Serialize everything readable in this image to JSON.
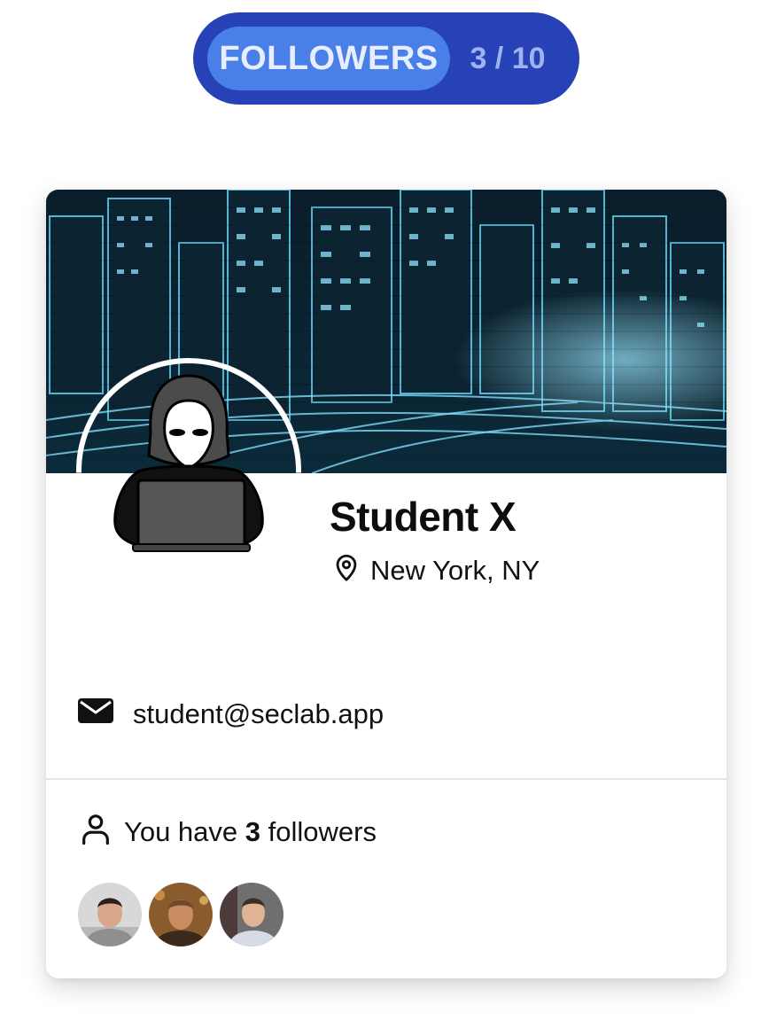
{
  "badge": {
    "label": "FOLLOWERS",
    "count": "3 / 10"
  },
  "profile": {
    "name": "Student X",
    "location": "New York, NY",
    "email": "student@seclab.app"
  },
  "followers": {
    "prefix": "You have",
    "count": "3",
    "suffix": "followers",
    "avatars": [
      "follower-1",
      "follower-2",
      "follower-3"
    ]
  },
  "colors": {
    "pill_bg": "#2741b6",
    "pill_label_bg": "#4a7fe8",
    "cover_glow": "#5fd0f0"
  },
  "icons": {
    "location": "map-pin-icon",
    "email": "envelope-icon",
    "followers": "user-icon"
  }
}
